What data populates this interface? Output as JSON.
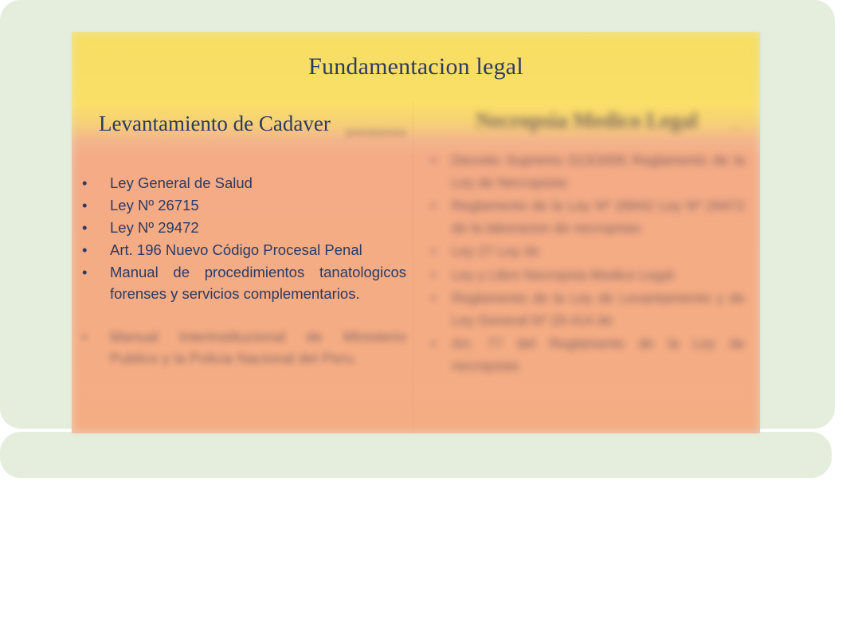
{
  "slide": {
    "title": "Fundamentacion legal",
    "background_color": "#e5eedd",
    "banner_color": "#f8de64",
    "panel_color": "#f4ad83",
    "text_color": "#2d3a63"
  },
  "left_column": {
    "heading": "Levantamiento de Cadaver",
    "ghost_subheading": "precisiones",
    "bullet_glyph": "•",
    "items": [
      "Ley General de Salud",
      "Ley Nº 26715",
      "Ley Nº 29472",
      "Art. 196 Nuevo Código Procesal Penal",
      "Manual de procedimientos tanatologicos forenses y servicios complementarios."
    ],
    "blurred_item": "Manual Interinstitucional de Ministerio Publico y la Policia Nacional del Peru."
  },
  "right_column": {
    "heading": "Necropsia Medico Legal",
    "heading_tail": "...",
    "bullet_glyph": "•",
    "items": [
      "Decreto Supremo 013/2005 Reglamento de la Ley de Necropsias",
      "Reglamento de la Ley Nº 26842 Ley Nº 29472 de la laboracion de necropsias",
      "Ley 27 Ley de",
      "Ley y Libro Necropsia Medico Legal",
      "Reglamento de la Ley de Levantamiento y de Ley General Nº 29 414 de",
      "Art. 77 del Reglamento de la Ley de necropsias"
    ]
  }
}
